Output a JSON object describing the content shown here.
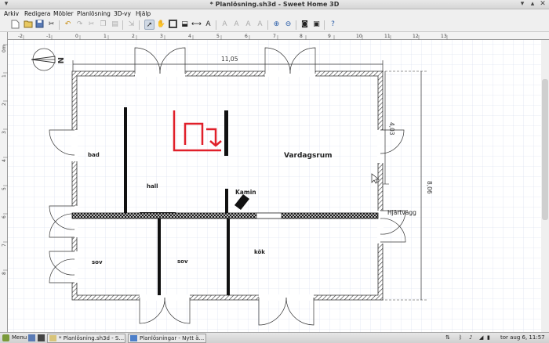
{
  "window": {
    "title": "* Planlösning.sh3d - Sweet Home 3D",
    "minimize_icon": "minimize-icon",
    "maximize_icon": "maximize-icon",
    "close_icon": "close-icon"
  },
  "menu": [
    "Arkiv",
    "Redigera",
    "Möbler",
    "Planlösning",
    "3D-vy",
    "Hjälp"
  ],
  "toolbar_icons": [
    "new-file-icon",
    "open-icon",
    "save-icon",
    "cut-icon",
    "undo-icon",
    "redo-icon",
    "delete-icon",
    "copy-icon",
    "paste-icon",
    "add-furniture-icon",
    "select-mode-icon",
    "pan-mode-icon",
    "create-walls-icon",
    "create-rooms-icon",
    "create-dimensions-icon",
    "add-text-icon",
    "text-bold-icon",
    "text-italic-icon",
    "increase-text-icon",
    "decrease-text-icon",
    "zoom-in-icon",
    "zoom-out-icon",
    "create-photo-icon",
    "create-video-icon",
    "help-icon"
  ],
  "ruler": {
    "top_labels": [
      "-2",
      "-1",
      "0",
      "1",
      "2",
      "3",
      "4",
      "5",
      "6",
      "7",
      "8",
      "9",
      "10",
      "11",
      "12",
      "13"
    ],
    "left_labels": [
      "0m",
      "1",
      "2",
      "3",
      "4",
      "5",
      "6",
      "7",
      "8"
    ]
  },
  "plan": {
    "compass_label": "N",
    "dimension_width": "11,05",
    "dimension_height": "8,06",
    "dimension_room": "4,03",
    "rooms": {
      "bad": "bad",
      "hall": "hall",
      "living": "Vardagsrum",
      "sov1": "sov",
      "sov2": "sov",
      "kitchen": "kök"
    },
    "labels": {
      "fireplace": "Kamin",
      "heart_wall": "Hjärtvägg"
    },
    "colors": {
      "stairs": "#e0202a",
      "grid": "#c8d4e8",
      "wall_hatch": "#333333"
    }
  },
  "taskbar": {
    "menu_label": "Menu",
    "tasks": [
      "* Planlösning.sh3d - S...",
      "Planlösningar - Nytt ä..."
    ],
    "clock": "tor aug  6, 11:57"
  }
}
